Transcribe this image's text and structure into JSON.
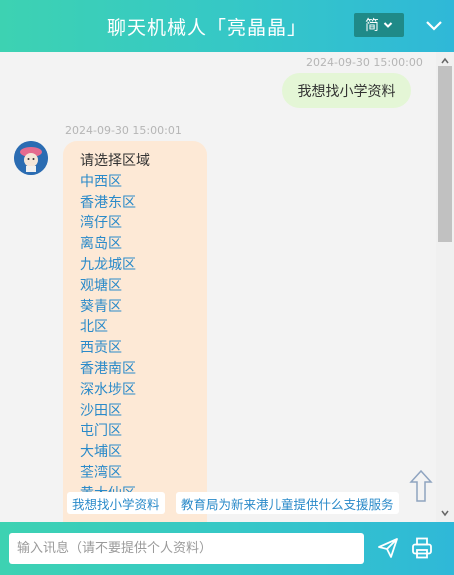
{
  "header": {
    "title": "聊天机械人「亮晶晶」",
    "language_label": "简"
  },
  "messages": {
    "user": {
      "timestamp": "2024-09-30 15:00:00",
      "text": "我想找小学资料"
    },
    "bot": {
      "timestamp": "2024-09-30 15:00:01",
      "prompt": "请选择区域",
      "options": [
        "中西区",
        "香港东区",
        "湾仔区",
        "离岛区",
        "九龙城区",
        "观塘区",
        "葵青区",
        "北区",
        "西贡区",
        "香港南区",
        "深水埗区",
        "沙田区",
        "屯门区",
        "大埔区",
        "荃湾区",
        "黄大仙区"
      ]
    }
  },
  "suggestions": [
    "我想找小学资料",
    "教育局为新来港儿童提供什么支援服务"
  ],
  "input": {
    "placeholder": "输入讯息（请不要提供个人资料）",
    "value": ""
  },
  "colors": {
    "header_start": "#3dd2b2",
    "header_end": "#2fb8d8",
    "link": "#2a8ac9",
    "user_bubble": "#e4f6d6",
    "bot_bubble": "#fde9d6"
  },
  "icons": {
    "language_dropdown": "chevron-down-icon",
    "collapse": "chevron-down-icon",
    "avatar": "bot-avatar-icon",
    "back_to_top": "arrow-up-icon",
    "send": "send-icon",
    "print": "print-icon"
  }
}
